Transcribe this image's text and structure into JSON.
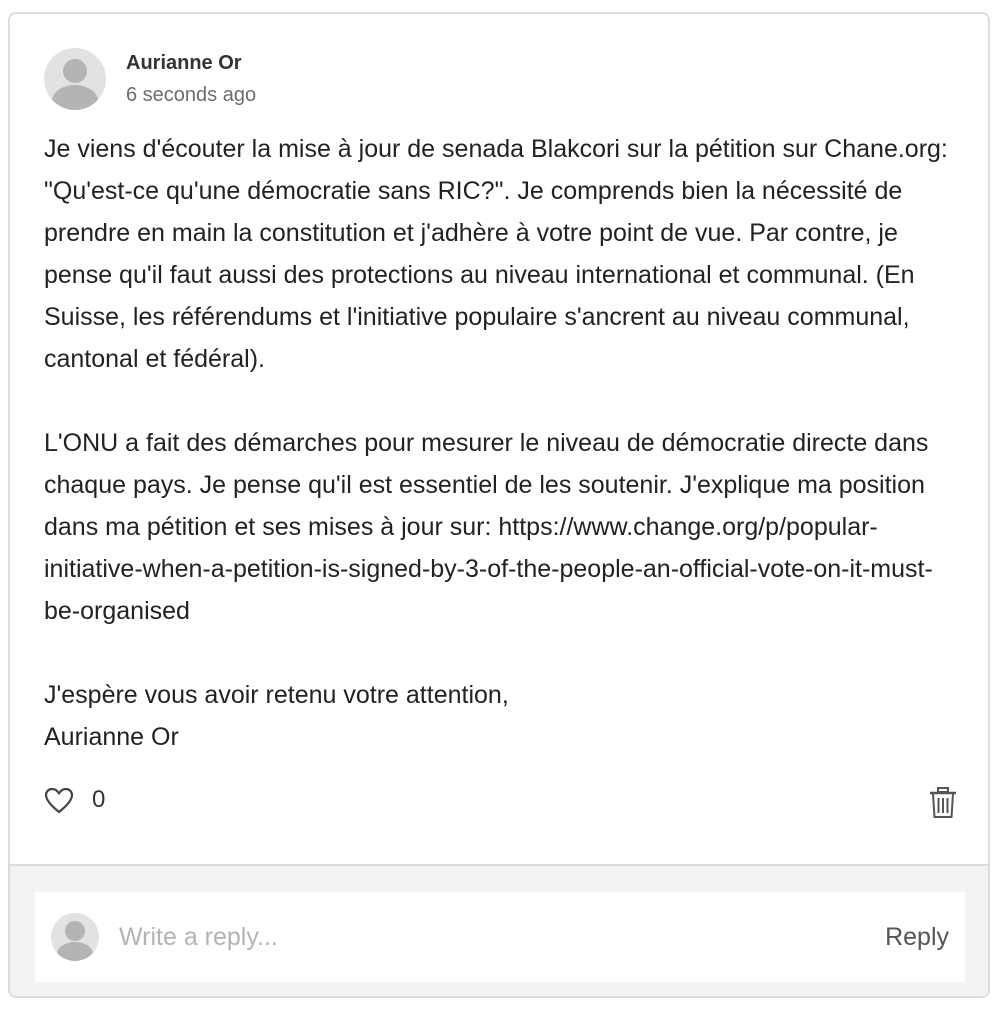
{
  "comment": {
    "author": "Aurianne Or",
    "timestamp": "6 seconds ago",
    "paragraphs": [
      "Je viens d'écouter la mise à jour de senada Blakcori sur la pétition sur Chane.org: \"Qu'est-ce qu'une démocratie sans RIC?\". Je comprends bien la nécessité de prendre en main la constitution et j'adhère à votre point de vue. Par contre, je pense qu'il faut aussi des protections au niveau international et communal. (En Suisse, les référendums et l'initiative populaire s'ancrent au niveau communal, cantonal et fédéral).",
      "L'ONU a fait des démarches pour mesurer le niveau de démocratie directe dans chaque pays. Je pense qu'il est essentiel de les soutenir. J'explique ma position dans ma pétition et ses mises à jour sur: https://www.change.org/p/popular-initiative-when-a-petition-is-signed-by-3-of-the-people-an-official-vote-on-it-must-be-organised",
      "J'espère vous avoir retenu votre attention,\nAurianne Or"
    ],
    "like_icon": "heart-outline-icon",
    "like_count": "0",
    "delete_icon": "trash-icon"
  },
  "reply": {
    "placeholder": "Write a reply...",
    "button_label": "Reply",
    "avatar_icon": "user-avatar-icon"
  },
  "colors": {
    "border": "#dcdcdc",
    "reply_area_bg": "#f3f3f3",
    "avatar_bg": "#e2e2e2",
    "avatar_fg": "#b4b4b4",
    "text": "#222222",
    "muted": "#6d6d6d"
  }
}
